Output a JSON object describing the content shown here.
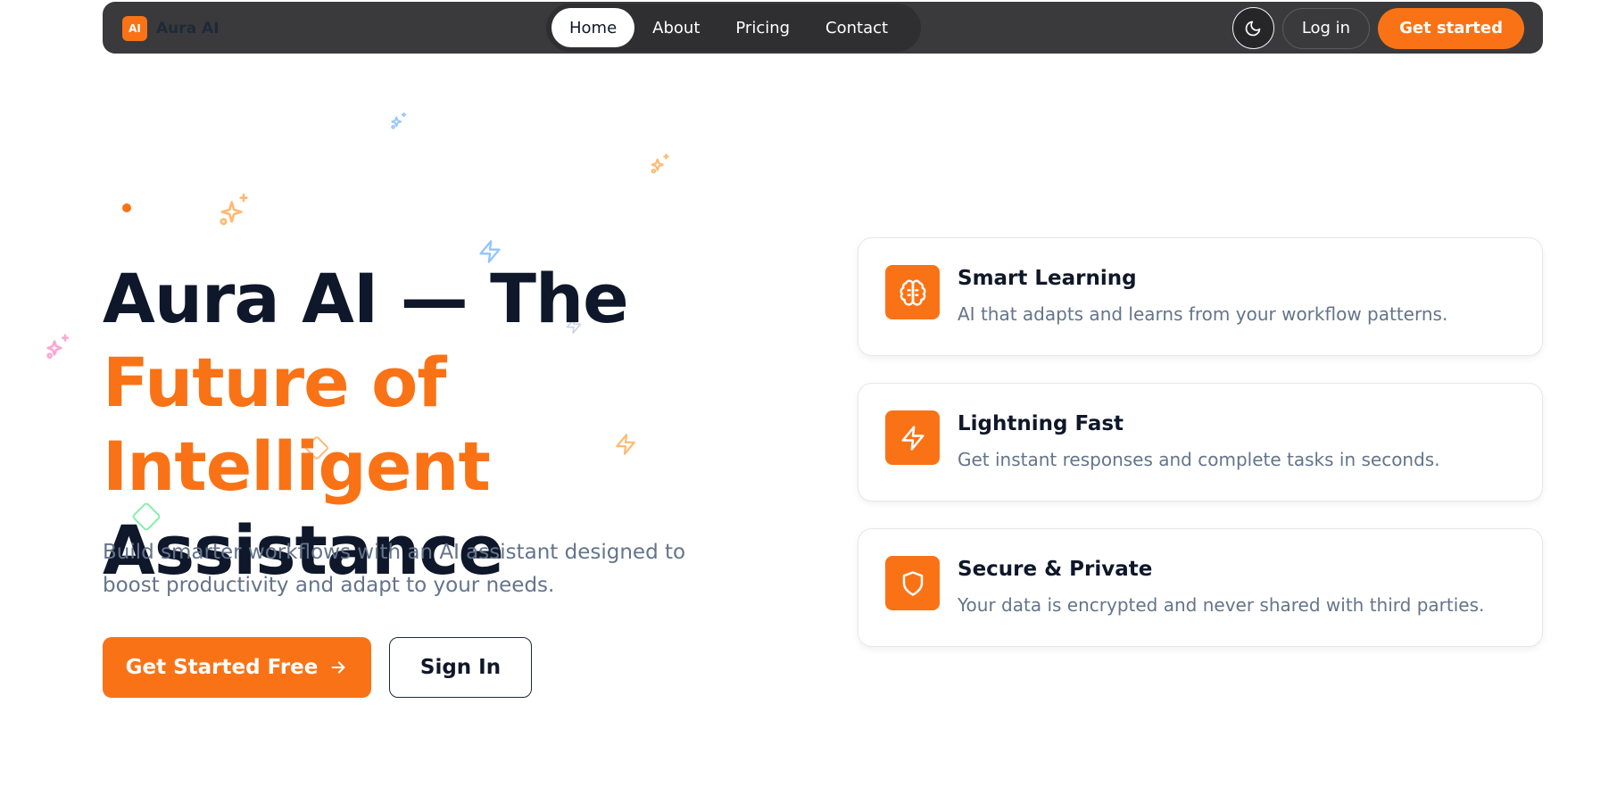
{
  "brand": {
    "badge": "AI",
    "name": "Aura AI"
  },
  "nav": {
    "links": [
      {
        "label": "Home",
        "active": true
      },
      {
        "label": "About",
        "active": false
      },
      {
        "label": "Pricing",
        "active": false
      },
      {
        "label": "Contact",
        "active": false
      }
    ],
    "theme_icon": "moon-icon",
    "login_label": "Log in",
    "cta_label": "Get started"
  },
  "hero": {
    "title_line1": "Aura AI — The",
    "title_line2": "Future of Intelligent",
    "title_line3": "Assistance",
    "subtitle": "Build smarter workflows with an AI assistant designed to boost productivity and adapt to your needs.",
    "primary_label": "Get Started Free",
    "primary_icon": "arrow-right-icon",
    "secondary_label": "Sign In"
  },
  "features": [
    {
      "icon": "brain-icon",
      "title": "Smart Learning",
      "description": "AI that adapts and learns from your workflow patterns."
    },
    {
      "icon": "lightning-icon",
      "title": "Lightning Fast",
      "description": "Get instant responses and complete tasks in seconds."
    },
    {
      "icon": "shield-icon",
      "title": "Secure & Private",
      "description": "Your data is encrypted and never shared with third parties."
    }
  ],
  "colors": {
    "accent": "#f97316",
    "nav_bg": "#3a3a3c",
    "heading": "#0f172a",
    "muted": "#64748b"
  }
}
